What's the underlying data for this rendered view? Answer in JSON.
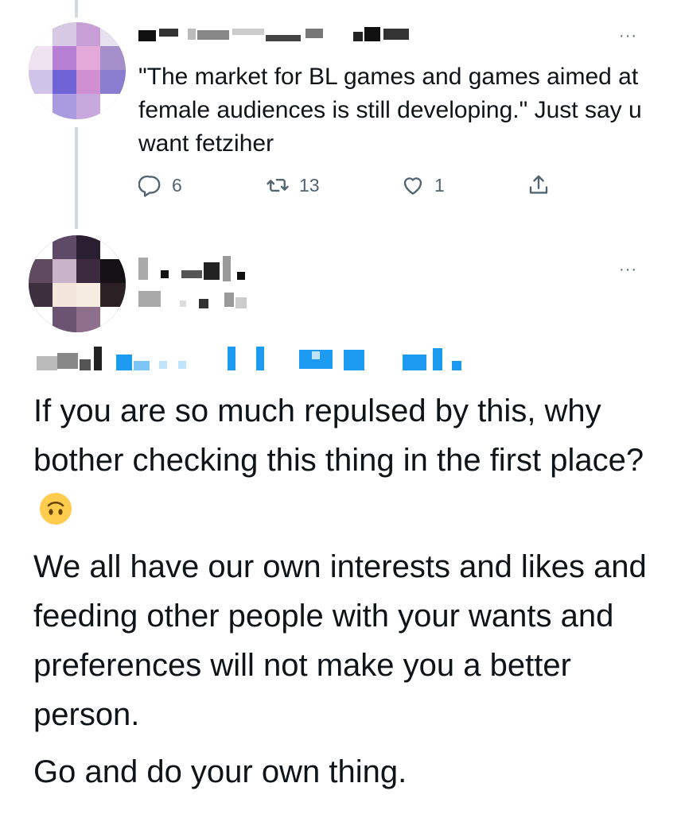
{
  "tweet1": {
    "text": "\"The market for BL games and games aimed at female audiences is still developing.\" Just say u want fetziher",
    "more_glyph": "···",
    "actions": {
      "reply_count": "6",
      "retweet_count": "13",
      "like_count": "1",
      "share_count": ""
    },
    "icons": {
      "reply": "reply-icon",
      "retweet": "retweet-icon",
      "like": "heart-icon",
      "share": "share-icon",
      "more": "more-icon"
    }
  },
  "tweet2": {
    "more_glyph": "···",
    "paragraphs": [
      "If you are so much repulsed by this, why bother checking this thing in the first place?",
      "We all have our own interests and likes and feeding other people with your wants and preferences will not make you a better person.",
      "Go and do your own thing."
    ],
    "emoji": "upside-down-face-emoji"
  },
  "colors": {
    "text": "#0f1419",
    "secondary": "#536471",
    "thread_line": "#cfd9de",
    "mention_blue": "#1d9bf0"
  }
}
